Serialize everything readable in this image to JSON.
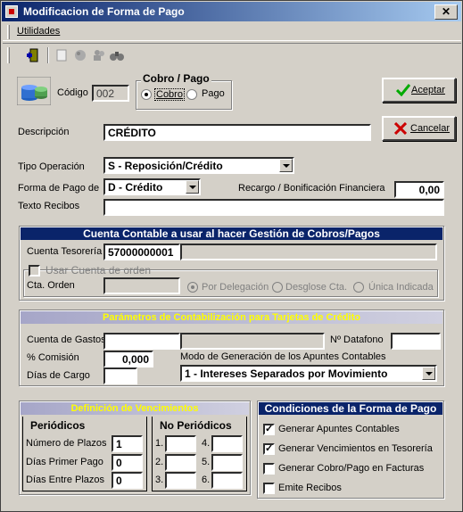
{
  "window": {
    "title": "Modificacion de Forma de Pago",
    "close": "✕"
  },
  "menu": {
    "utilidades": "Utilidades"
  },
  "header": {
    "codigo_label": "Código",
    "codigo_value": "002",
    "cobro_pago_title": "Cobro / Pago",
    "cobro": "Cobro",
    "pago": "Pago",
    "selected": "Cobro"
  },
  "buttons": {
    "aceptar": "Aceptar",
    "cancelar": "Cancelar"
  },
  "form": {
    "descripcion_label": "Descripción",
    "descripcion_value": "CRÉDITO",
    "tipo_operacion_label": "Tipo Operación",
    "tipo_operacion_value": "S - Reposición/Crédito",
    "forma_pago_label": "Forma de Pago de",
    "forma_pago_value": "D - Crédito",
    "recargo_label": "Recargo / Bonificación Financiera",
    "recargo_value": "0,00",
    "texto_recibos_label": "Texto Recibos",
    "texto_recibos_value": ""
  },
  "cuenta_contable": {
    "title": "Cuenta Contable a usar al hacer Gestión de Cobros/Pagos",
    "tesoreria_label": "Cuenta Tesorería",
    "tesoreria_value": "57000000001",
    "usar_orden_label": "Usar Cuenta de orden",
    "cta_orden_label": "Cta. Orden",
    "por_delegacion": "Por Delegación",
    "desglose_cta": "Desglose Cta.",
    "unica_indicada": "Única Indicada"
  },
  "tarjetas": {
    "title": "Parámetros de Contabilización para Tarjetas de Crédito",
    "cuenta_gastos_label": "Cuenta de Gastos",
    "n_datafono_label": "Nº Datafono",
    "comision_label": "% Comisión",
    "comision_value": "0,000",
    "modo_label": "Modo de Generación de los Apuntes Contables",
    "modo_value": "1 - Intereses Separados por Movimiento",
    "dias_cargo_label": "Días de Cargo"
  },
  "vencimientos": {
    "title": "Definición de Vencimientos",
    "periodicos": "Periódicos",
    "no_periodicos": "No Periódicos",
    "numero_plazos_label": "Número de Plazos",
    "numero_plazos_value": "1",
    "dias_primer_pago_label": "Días Primer Pago",
    "dias_primer_pago_value": "0",
    "dias_entre_plazos_label": "Días Entre Plazos",
    "dias_entre_plazos_value": "0",
    "np_labels": [
      "1.",
      "2.",
      "3.",
      "4.",
      "5.",
      "6."
    ]
  },
  "condiciones": {
    "title": "Condiciones de la Forma de Pago",
    "items": [
      {
        "label": "Generar Apuntes Contables",
        "checked": true
      },
      {
        "label": "Generar Vencimientos en Tesorería",
        "checked": true
      },
      {
        "label": "Generar Cobro/Pago en Facturas",
        "checked": false
      },
      {
        "label": "Emite Recibos",
        "checked": false
      }
    ]
  }
}
